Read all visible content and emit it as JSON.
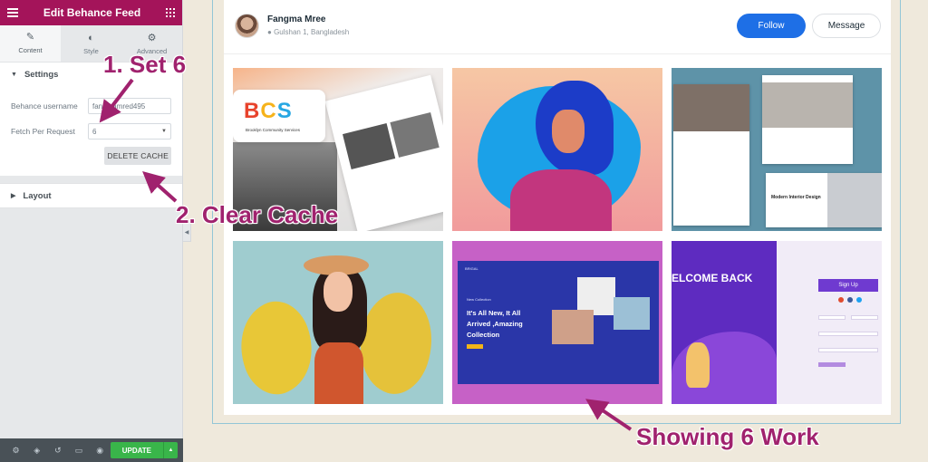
{
  "panel": {
    "title": "Edit Behance Feed",
    "tabs": [
      {
        "label": "Content",
        "icon": "pencil-icon"
      },
      {
        "label": "Style",
        "icon": "half-circle-icon"
      },
      {
        "label": "Advanced",
        "icon": "gear-icon"
      }
    ],
    "settings": {
      "heading": "Settings",
      "username_label": "Behance username",
      "username_value": "fangmamred495",
      "fetch_label": "Fetch Per Request",
      "fetch_value": "6",
      "delete_cache_label": "DELETE CACHE"
    },
    "layout_heading": "Layout",
    "footer": {
      "icons": [
        "gear-icon",
        "layers-icon",
        "history-icon",
        "responsive-icon",
        "eye-icon"
      ],
      "update_label": "UPDATE"
    },
    "accent": "#a4145a"
  },
  "profile": {
    "name": "Fangma Mree",
    "location": "Gulshan 1, Bangladesh",
    "follow_label": "Follow",
    "message_label": "Message"
  },
  "tiles": {
    "t1": {
      "logo_b": "B",
      "logo_c": "C",
      "logo_s": "S",
      "sub": "Brooklyn Community Services"
    },
    "t3": {
      "heading": "Modern Interior Design"
    },
    "t5": {
      "nav": "BRIGAL",
      "small": "New Collection",
      "title_1": "It's All New, It All",
      "title_2": "Arrived ,Amazing",
      "title_3": "Collection"
    },
    "t6": {
      "welcome": "ELCOME BACK",
      "signup": "Sign Up"
    }
  },
  "annotations": {
    "step1": "1. Set 6",
    "step2": "2. Clear Cache",
    "step3": "Showing 6 Work",
    "color": "#a0226e"
  }
}
